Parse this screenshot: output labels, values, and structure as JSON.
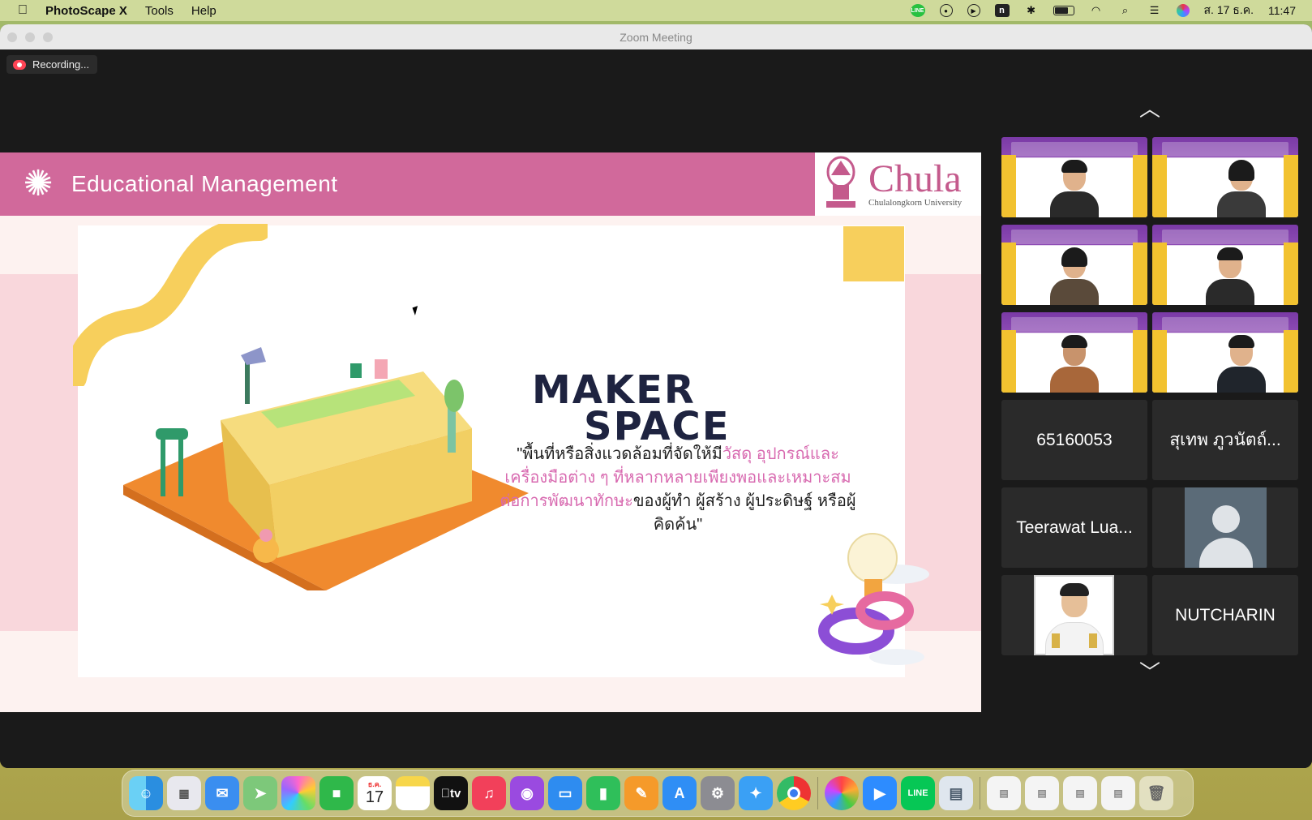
{
  "menubar": {
    "apple_icon": "apple-icon",
    "app_name": "PhotoScape X",
    "menus": [
      "Tools",
      "Help"
    ],
    "line_icon_label": "LINE",
    "notion_icon_label": "n",
    "date": "ส. 17 ธ.ค.",
    "time": "11:47"
  },
  "window": {
    "title": "Zoom Meeting",
    "recording_label": "Recording..."
  },
  "slide": {
    "header_title": "Educational Management",
    "logo_main": "Chula",
    "logo_sub": "Chulalongkorn University",
    "heading_line1": "MAKER",
    "heading_line2": "SPACE",
    "quote": {
      "part1": "\"พื้นที่หรือสิ่งแวดล้อมที่จัดให้มี",
      "part2_highlight": "วัสดุ อุปกรณ์และเครื่องมือต่าง ๆ ที่หลากหลายเพียงพอและเหมาะสมต่อการพัฒนาทักษะ",
      "part3": "ของผู้ทำ ผู้สร้าง ผู้ประดิษฐ์ หรือผู้คิดค้น\""
    }
  },
  "gallery": {
    "participants": [
      {
        "type": "video"
      },
      {
        "type": "video"
      },
      {
        "type": "video"
      },
      {
        "type": "video"
      },
      {
        "type": "video"
      },
      {
        "type": "video"
      },
      {
        "type": "name",
        "name": "65160053"
      },
      {
        "type": "name",
        "name": "สุเทพ ภูวนัตถ์..."
      },
      {
        "type": "name",
        "name": "Teerawat Lua..."
      },
      {
        "type": "avatar"
      },
      {
        "type": "photo"
      },
      {
        "type": "name",
        "name": "NUTCHARIN"
      }
    ]
  },
  "dock": {
    "calendar_month": "ธ.ค.",
    "calendar_day": "17",
    "tv_label": "tv",
    "apps": [
      "finder-icon",
      "launchpad-icon",
      "mail-icon",
      "maps-icon",
      "photos-icon",
      "facetime-icon",
      "calendar-icon",
      "notes-icon",
      "appletv-icon",
      "music-icon",
      "podcasts-icon",
      "keynote-icon",
      "numbers-icon",
      "pages-icon",
      "appstore-icon",
      "settings-icon",
      "safari-icon",
      "chrome-icon",
      "photoscape-icon",
      "zoom-icon",
      "line-icon",
      "preview-icon"
    ]
  },
  "colors": {
    "slide_header": "#d1699b",
    "slide_highlight": "#d86ab0",
    "accent_yellow": "#f7cf5c",
    "zoom_bg": "#1a1a1a"
  }
}
